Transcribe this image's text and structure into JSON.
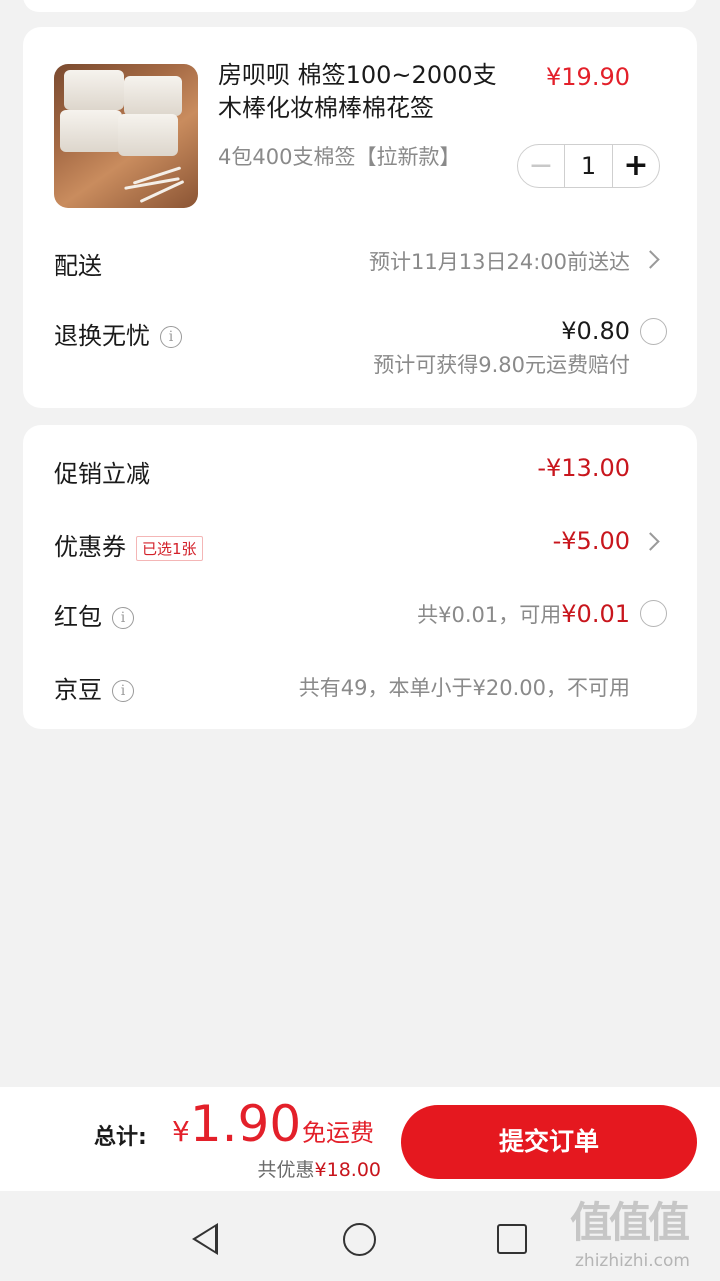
{
  "product": {
    "title": "房呗呗 棉签100~2000支木棒化妆棉棒棉花签",
    "price": "¥19.90",
    "spec": "4包400支棉签【拉新款】",
    "quantity": "1",
    "minus": "−",
    "plus": "+"
  },
  "delivery": {
    "label": "配送",
    "value": "预计11月13日24:00前送达"
  },
  "return_service": {
    "label": "退换无忧",
    "price": "¥0.80",
    "note": "预计可获得9.80元运费赔付",
    "selected": false
  },
  "discounts": {
    "promo": {
      "label": "促销立减",
      "value": "-¥13.00"
    },
    "coupon": {
      "label": "优惠券",
      "tag": "已选1张",
      "value": "-¥5.00"
    },
    "red_packet": {
      "label": "红包",
      "total": "共¥0.01，可用",
      "available": "¥0.01",
      "selected": false
    },
    "jingdou": {
      "label": "京豆",
      "note": "共有49，本单小于¥20.00，不可用"
    }
  },
  "footer": {
    "total_label": "总计:",
    "currency": "¥",
    "total": "1.90",
    "free_shipping": "免运费",
    "saved_label": "共优惠",
    "saved_amount": "¥18.00",
    "submit_label": "提交订单"
  },
  "watermark": {
    "glyphs": "值值值",
    "domain": "zhizhizhi.com"
  },
  "colors": {
    "accent": "#e5181f",
    "price_red": "#e3202a",
    "background": "#f2f2f2"
  },
  "icons": [
    "info-icon",
    "chevron-right-icon",
    "radio-icon",
    "nav-back-icon",
    "nav-home-icon",
    "nav-recent-icon"
  ]
}
